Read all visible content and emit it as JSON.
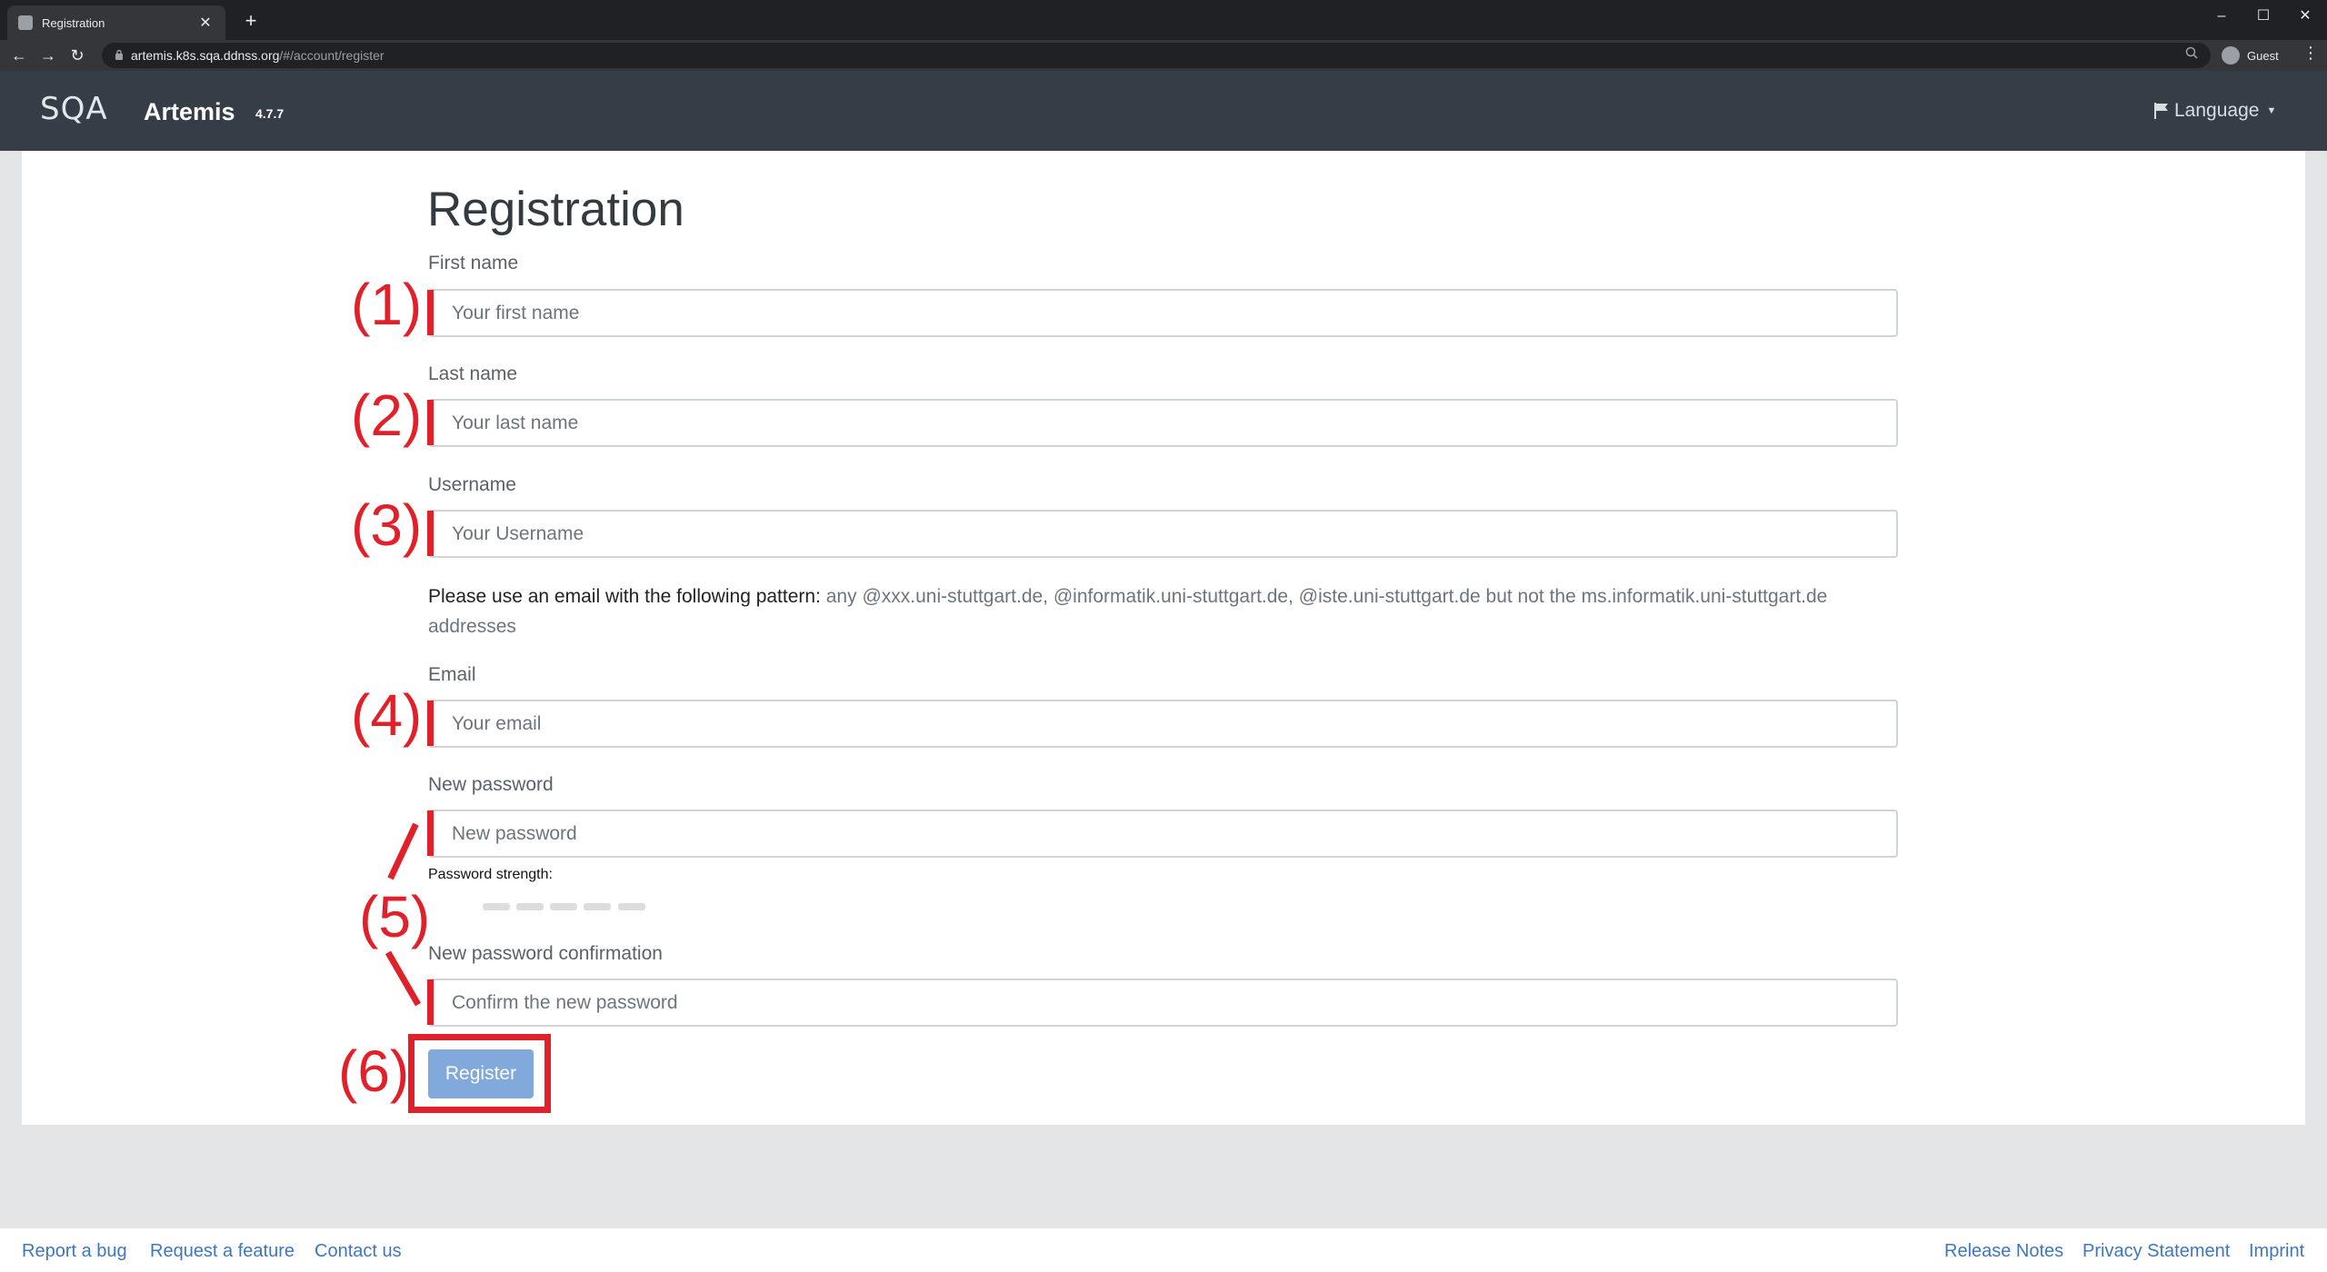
{
  "browser": {
    "tab_title": "Registration",
    "new_tab": "+",
    "url_host": "artemis.k8s.sqa.ddnss.org",
    "url_path": "/#/account/register",
    "profile": "Guest",
    "controls": {
      "minimize": "–",
      "maximize": "☐",
      "close": "✕"
    },
    "back": "←",
    "forward": "→",
    "reload": "↻",
    "menu": "⋮"
  },
  "appbar": {
    "logo_text": "SQA",
    "brand": "Artemis",
    "version": "4.7.7",
    "language": "Language"
  },
  "form": {
    "title": "Registration",
    "first_name": {
      "label": "First name",
      "placeholder": "Your first name"
    },
    "last_name": {
      "label": "Last name",
      "placeholder": "Your last name"
    },
    "username": {
      "label": "Username",
      "placeholder": "Your Username"
    },
    "email_hint_bold": "Please use an email with the following pattern:",
    "email_hint": " any @xxx.uni-stuttgart.de, @informatik.uni-stuttgart.de, @iste.uni-stuttgart.de but not the ms.informatik.uni-stuttgart.de addresses",
    "email": {
      "label": "Email",
      "placeholder": "Your email"
    },
    "new_password": {
      "label": "New password",
      "placeholder": "New password"
    },
    "password_strength": "Password strength:",
    "confirm_password": {
      "label": "New password confirmation",
      "placeholder": "Confirm the new password"
    },
    "register": "Register"
  },
  "annotations": [
    "(1)",
    "(2)",
    "(3)",
    "(4)",
    "(5)",
    "(6)"
  ],
  "footer": {
    "left": [
      "Report a bug",
      "Request a feature",
      "Contact us"
    ],
    "right": [
      "Release Notes",
      "Privacy Statement",
      "Imprint"
    ]
  },
  "colors": {
    "annotation_red": "#e2202a",
    "navbar": "#353d47",
    "link": "#3e77c1",
    "button": "#82a9dc"
  }
}
